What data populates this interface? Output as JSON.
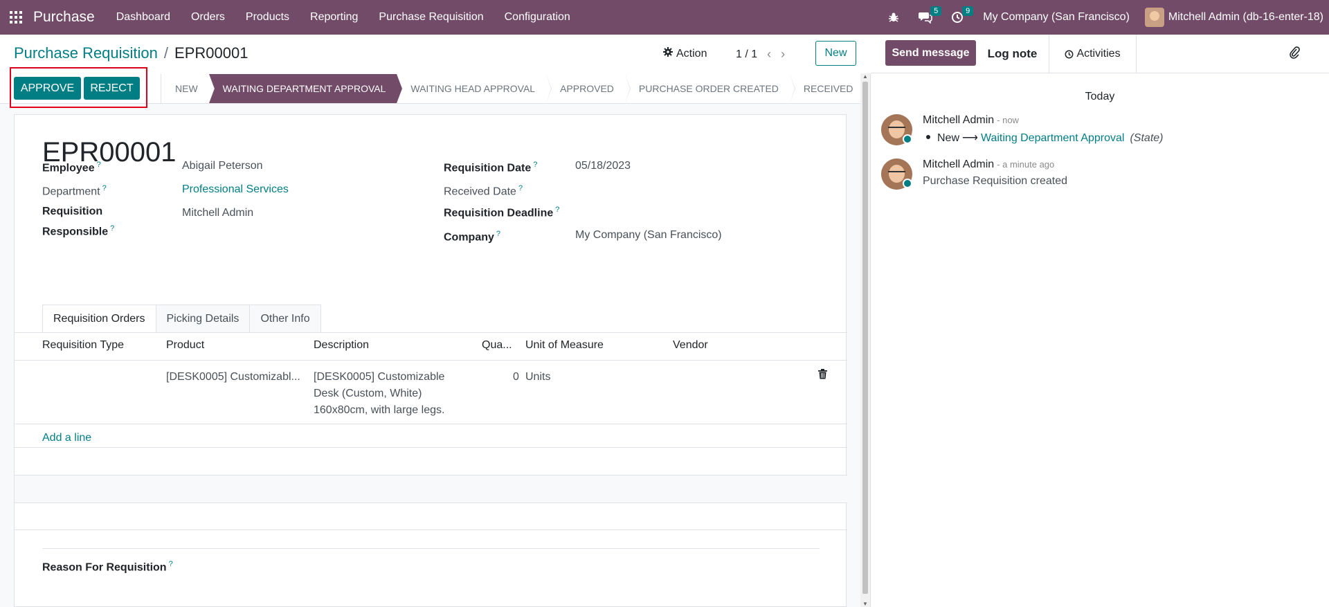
{
  "navbar": {
    "brand": "Purchase",
    "menu": [
      "Dashboard",
      "Orders",
      "Products",
      "Reporting",
      "Purchase Requisition",
      "Configuration"
    ],
    "messages_count": "5",
    "activities_count": "9",
    "company": "My Company (San Francisco)",
    "user": "Mitchell Admin (db-16-enter-18)"
  },
  "control_panel": {
    "breadcrumb_parent": "Purchase Requisition",
    "breadcrumb_separator": "/",
    "breadcrumb_current": "EPR00001",
    "action_label": "Action",
    "pager": "1 / 1",
    "new_label": "New"
  },
  "status_buttons": {
    "approve": "APPROVE",
    "reject": "REJECT"
  },
  "stages": [
    {
      "label": "NEW",
      "active": false
    },
    {
      "label": "WAITING DEPARTMENT APPROVAL",
      "active": true
    },
    {
      "label": "WAITING HEAD APPROVAL",
      "active": false
    },
    {
      "label": "APPROVED",
      "active": false
    },
    {
      "label": "PURCHASE ORDER CREATED",
      "active": false
    },
    {
      "label": "RECEIVED",
      "active": false
    }
  ],
  "record": {
    "title": "EPR00001",
    "fields_left": {
      "employee_label": "Employee",
      "employee_value": "Abigail Peterson",
      "department_label": "Department",
      "department_value": "Professional Services",
      "responsible_label_1": "Requisition",
      "responsible_label_2": "Responsible",
      "responsible_value": "Mitchell Admin"
    },
    "fields_right": {
      "req_date_label": "Requisition Date",
      "req_date_value": "05/18/2023",
      "received_label": "Received Date",
      "deadline_label": "Requisition Deadline",
      "company_label": "Company",
      "company_value": "My Company (San Francisco)"
    },
    "help_mark": "?"
  },
  "tabs": [
    "Requisition Orders",
    "Picking Details",
    "Other Info"
  ],
  "table": {
    "headers": [
      "Requisition Type",
      "Product",
      "Description",
      "Qua...",
      "Unit of Measure",
      "Vendor"
    ],
    "rows": [
      {
        "type": "",
        "product": "[DESK0005] Customizabl...",
        "description_lines": [
          "[DESK0005] Customizable",
          "Desk (Custom, White)",
          "160x80cm, with large legs."
        ],
        "quantity": "0",
        "uom": "Units",
        "vendor": ""
      }
    ],
    "add_line": "Add a line"
  },
  "reason_label": "Reason For Requisition",
  "chatter": {
    "send_message": "Send message",
    "log_note": "Log note",
    "activities": "Activities",
    "date_separator": "Today",
    "messages": [
      {
        "author": "Mitchell Admin",
        "time": "- now",
        "tracking_old": "New",
        "tracking_arrow": "⟶",
        "tracking_new": "Waiting Department Approval",
        "tracking_field": "(State)"
      },
      {
        "author": "Mitchell Admin",
        "time": "- a minute ago",
        "body": "Purchase Requisition created"
      }
    ]
  },
  "colors": {
    "brand": "#714B67",
    "accent": "#017E84",
    "highlight": "#e0001b"
  }
}
